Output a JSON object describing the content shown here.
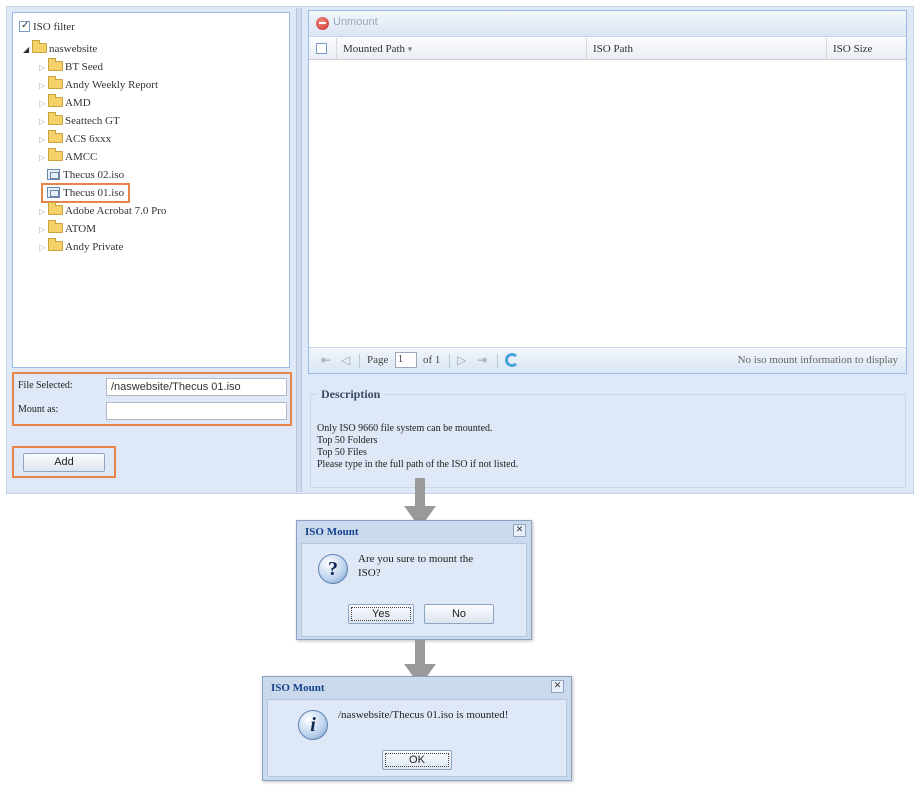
{
  "tree": {
    "root_label": "ISO filter",
    "items": [
      {
        "label": "naswebsite",
        "type": "folder-open"
      },
      {
        "label": "BT Seed",
        "type": "folder"
      },
      {
        "label": "Andy Weekly Report",
        "type": "folder"
      },
      {
        "label": "AMD",
        "type": "folder"
      },
      {
        "label": "Seattech GT",
        "type": "folder"
      },
      {
        "label": "ACS 6xxx",
        "type": "folder"
      },
      {
        "label": "AMCC",
        "type": "folder"
      },
      {
        "label": "Thecus 02.iso",
        "type": "iso"
      },
      {
        "label": "Thecus 01.iso",
        "type": "iso",
        "selected": true
      },
      {
        "label": "Adobe Acrobat 7.0 Pro",
        "type": "folder"
      },
      {
        "label": "ATOM",
        "type": "folder"
      },
      {
        "label": "Andy Private",
        "type": "folder"
      }
    ]
  },
  "form": {
    "file_selected_label": "File Selected:",
    "file_selected_value": "/naswebsite/Thecus 01.iso",
    "mount_as_label": "Mount as:",
    "mount_as_value": "",
    "add_button": "Add"
  },
  "grid": {
    "toolbar_unmount": "Unmount",
    "columns": [
      "Mounted Path",
      "ISO Path",
      "ISO Size"
    ],
    "sort_indicator": "▾",
    "pager": {
      "page_label": "Page",
      "page_value": "1",
      "of_label": "of 1",
      "status": "No iso mount information to display"
    }
  },
  "description": {
    "title": "Description",
    "lines": [
      "Only ISO 9660 file system can be mounted.",
      "Top 50 Folders",
      "Top 50 Files",
      "Please type in the full path of the ISO if not listed."
    ]
  },
  "confirm_dialog": {
    "title": "ISO Mount",
    "message_line1": "Are you sure to mount the",
    "message_line2": "ISO?",
    "yes": "Yes",
    "no": "No",
    "icon": "question-icon"
  },
  "result_dialog": {
    "title": "ISO Mount",
    "message": "/naswebsite/Thecus 01.iso is mounted!",
    "ok": "OK",
    "icon": "info-icon"
  },
  "colors": {
    "highlight": "#e8834a",
    "panel": "#dfe8f6",
    "title_blue": "#15428b"
  }
}
